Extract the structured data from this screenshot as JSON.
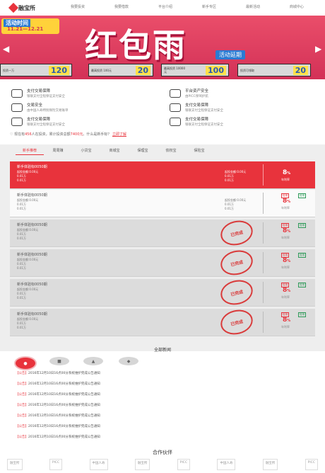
{
  "nav": {
    "logo_text": "融宝所",
    "links": [
      "我要投资",
      "我要借款",
      "平台介绍",
      "新手专区",
      "最新活动",
      "商城中心"
    ]
  },
  "banner": {
    "date_title": "活动时间",
    "date_range": "11.21—12.21",
    "title": "红包雨",
    "badge": "活动延期",
    "coupons": [
      {
        "desc": "投资一万",
        "amount": "120"
      },
      {
        "desc": "最高投资 100元",
        "amount": "20"
      },
      {
        "desc": "最高投资 10000元",
        "amount": "100"
      },
      {
        "desc": "投资可领取",
        "amount": "20"
      }
    ]
  },
  "features": [
    {
      "title": "支付交易保障",
      "sub": "银联支付全程保证支付安全"
    },
    {
      "title": "平台资产安全",
      "sub": "由PICC保驾护航"
    },
    {
      "title": "交易安全",
      "sub": "由中国人寿特别保险交易账单"
    },
    {
      "title": "支付交易保障",
      "sub": "银联支付全程保证支付安全"
    },
    {
      "title": "支付交易保障",
      "sub": "银联支付全程保证支付安全"
    },
    {
      "title": "支付交易保障",
      "sub": "银联支付全程保证支付安全"
    }
  ],
  "stats": {
    "p1": "现在有",
    "users": "456",
    "p2": "人在投资，累计投资总额",
    "total": "7400元",
    "p3": "。什么是新手标？",
    "link": "立即了解"
  },
  "tabs": [
    "新手推荐",
    "周周赚",
    "小贷宝",
    "商城宝",
    "保理宝",
    "债权宝",
    "保险宝"
  ],
  "products": [
    {
      "name": "新手体验标0050期",
      "l1": "起投金额:0.00元",
      "l2": "0.01万",
      "l3": "0.01万",
      "m1": "起投金额:0.00元",
      "m2": "0.01万",
      "m3": "0.01万",
      "rate": "8",
      "unit": "%",
      "rate_label": "年利率",
      "tag": "",
      "stamp": ""
    },
    {
      "name": "新手体验标0050期",
      "l1": "起投金额:0.00元",
      "l2": "0.01万",
      "l3": "0.01万",
      "m1": "起投金额:0.00元",
      "m2": "0.01万",
      "m3": "0.01万",
      "rate": "8",
      "unit": "%",
      "rate_label": "年利率",
      "tag": "信用",
      "stamp": ""
    },
    {
      "name": "新手体验标0050期",
      "l1": "起投金额:0.00元",
      "l2": "0.01万",
      "l3": "0.01万",
      "m1": "起投金额:0.00元",
      "m2": "0.01万",
      "m3": "0.01万",
      "rate": "8",
      "unit": "%",
      "rate_label": "年利率",
      "tag": "信用",
      "stamp": "已完成"
    },
    {
      "name": "新手体验标0050期",
      "l1": "起投金额:0.00元",
      "l2": "0.01万",
      "l3": "0.01万",
      "m1": "起投金额:0.00元",
      "m2": "0.01万",
      "m3": "0.01万",
      "rate": "8",
      "unit": "%",
      "rate_label": "年利率",
      "tag": "信用",
      "stamp": "已完成"
    },
    {
      "name": "新手体验标0050期",
      "l1": "起投金额:0.00元",
      "l2": "0.01万",
      "l3": "0.01万",
      "m1": "起投金额:0.00元",
      "m2": "0.01万",
      "m3": "0.01万",
      "rate": "8",
      "unit": "%",
      "rate_label": "年利率",
      "tag": "信用",
      "stamp": "已完成"
    },
    {
      "name": "新手体验标0050期",
      "l1": "起投金额:0.00元",
      "l2": "0.01万",
      "l3": "0.01万",
      "m1": "起投金额:0.00元",
      "m2": "0.01万",
      "m3": "0.01万",
      "rate": "8",
      "unit": "%",
      "rate_label": "年利率",
      "tag": "信用",
      "stamp": "已完成"
    }
  ],
  "news": {
    "title": "全部新闻",
    "icons": [
      "●",
      "■",
      "▲",
      "◆"
    ],
    "items": [
      {
        "tag": "【公告】",
        "text": "2016年12月10日16点00分系统维护完成公告通知"
      },
      {
        "tag": "【公告】",
        "text": "2016年12月10日16点00分系统维护完成公告通知"
      },
      {
        "tag": "【公告】",
        "text": "2016年12月10日16点00分系统维护完成公告通知"
      },
      {
        "tag": "【公告】",
        "text": "2016年12月10日16点00分系统维护完成公告通知"
      },
      {
        "tag": "【公告】",
        "text": "2016年12月10日16点00分系统维护完成公告通知"
      },
      {
        "tag": "【公告】",
        "text": "2016年12月10日16点00分系统维护完成公告通知"
      },
      {
        "tag": "【公告】",
        "text": "2016年12月10日16点00分系统维护完成公告通知"
      }
    ]
  },
  "partners": {
    "title": "合作伙伴",
    "items": [
      "融宝所",
      "PICC",
      "中国人寿",
      "融宝所",
      "PICC",
      "中国人寿",
      "融宝所",
      "PICC"
    ]
  },
  "colors": {
    "brand": "#e8333c",
    "banner": "#d33157",
    "accent_blue": "#2b7bd3",
    "gold": "#ffd23a"
  }
}
